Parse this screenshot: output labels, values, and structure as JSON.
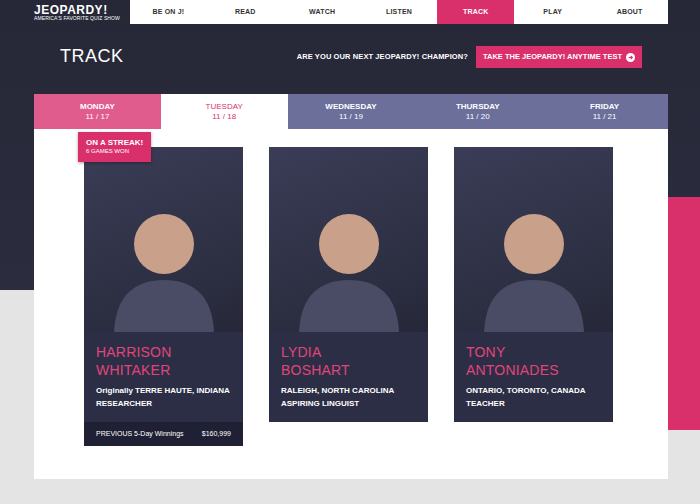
{
  "logo": {
    "title": "JEOPARDY!",
    "tagline": "AMERICA'S FAVORITE QUIZ SHOW"
  },
  "nav": [
    {
      "label": "BE ON J!",
      "selected": false
    },
    {
      "label": "READ",
      "selected": false
    },
    {
      "label": "WATCH",
      "selected": false
    },
    {
      "label": "LISTEN",
      "selected": false
    },
    {
      "label": "TRACK",
      "selected": true
    },
    {
      "label": "PLAY",
      "selected": false
    },
    {
      "label": "ABOUT",
      "selected": false
    }
  ],
  "page_title": "TRACK",
  "cta": {
    "prompt": "ARE YOU OUR NEXT JEOPARDY! CHAMPION?",
    "button": "TAKE THE JEOPARDY! ANYTIME TEST"
  },
  "days": [
    {
      "day": "MONDAY",
      "date": "11 / 17",
      "selected": false,
      "color": "#e05c8c"
    },
    {
      "day": "TUESDAY",
      "date": "11 / 18",
      "selected": true,
      "color": "#ffffff"
    },
    {
      "day": "WEDNESDAY",
      "date": "11 / 19",
      "selected": false,
      "color": "#6b6f9a"
    },
    {
      "day": "THURSDAY",
      "date": "11 / 20",
      "selected": false,
      "color": "#6b6f9a"
    },
    {
      "day": "FRIDAY",
      "date": "11 / 21",
      "selected": false,
      "color": "#6b6f9a"
    }
  ],
  "contestants": [
    {
      "name_lines": [
        "HARRISON",
        "WHITAKER"
      ],
      "hometown": "Originally TERRE HAUTE, INDIANA",
      "occupation": "RESEARCHER",
      "streak": {
        "title": "ON A STREAK!",
        "subtitle": "6 GAMES WON"
      },
      "winnings": {
        "label": "PREVIOUS 5-Day Winnings",
        "amount": "$160,999"
      }
    },
    {
      "name_lines": [
        "LYDIA",
        "BOSHART"
      ],
      "hometown": "RALEIGH, NORTH CAROLINA",
      "occupation": "ASPIRING LINGUIST"
    },
    {
      "name_lines": [
        "TONY",
        "ANTONIADES"
      ],
      "hometown": "ONTARIO, TORONTO, CANADA",
      "occupation": "TEACHER"
    }
  ]
}
